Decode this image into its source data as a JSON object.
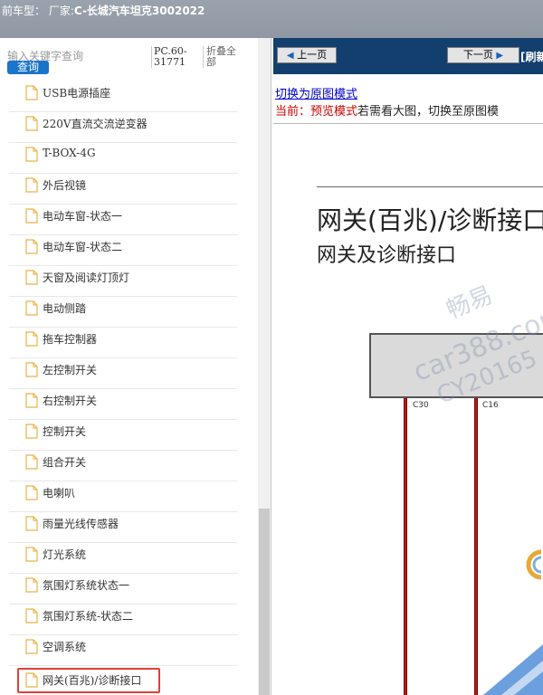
{
  "header": {
    "title_prefix": "前车型：  厂家:",
    "model": "C-长城汽车坦克3002022"
  },
  "left_panel": {
    "search_placeholder": "输入关键字查询",
    "search_button": "查询",
    "pc_label": "PC.60-31771",
    "collapse_all": "折叠全部",
    "items": [
      {
        "label": "USB电源插座"
      },
      {
        "label": "220V直流交流逆变器"
      },
      {
        "label": "T-BOX-4G"
      },
      {
        "label": "外后视镜"
      },
      {
        "label": "电动车窗-状态一"
      },
      {
        "label": "电动车窗-状态二"
      },
      {
        "label": "天窗及阅读灯顶灯"
      },
      {
        "label": "电动侧踏"
      },
      {
        "label": "拖车控制器"
      },
      {
        "label": "左控制开关"
      },
      {
        "label": "右控制开关"
      },
      {
        "label": "控制开关"
      },
      {
        "label": "组合开关"
      },
      {
        "label": "电喇叭"
      },
      {
        "label": "雨量光线传感器"
      },
      {
        "label": "灯光系统"
      },
      {
        "label": "氛围灯系统状态一"
      },
      {
        "label": "氛围灯系统-状态二"
      },
      {
        "label": "空调系统"
      },
      {
        "label": "网关(百兆)/诊断接口",
        "selected": true
      }
    ]
  },
  "right_panel": {
    "prev_button": "上一页",
    "next_button": "下一页",
    "refresh_link": "[刷新",
    "switch_mode_link": "切换为原图模式",
    "mode_current_label": "当前：",
    "mode_current_value": "预览模式",
    "mode_hint": "若需看大图，切换至原图模",
    "document": {
      "title": "网关(百兆)/诊断接口",
      "subtitle": "网关及诊断接口",
      "pin_labels": [
        "C30",
        "C16"
      ],
      "watermark_lines": [
        "畅易",
        "car388.com",
        "CY20165"
      ]
    }
  }
}
